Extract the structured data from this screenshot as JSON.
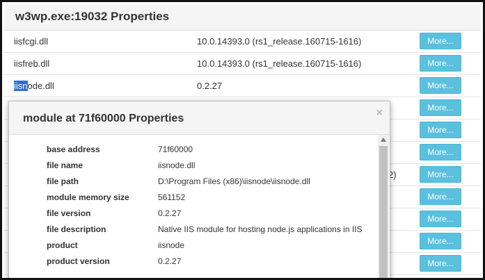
{
  "main": {
    "title": "w3wp.exe:19032 Properties",
    "rows": [
      {
        "name": "iisfcgi.dll",
        "version": "10.0.14393.0 (rs1_release.160715-1616)",
        "button": "More..."
      },
      {
        "name": "iisfreb.dll",
        "version": "10.0.14393.0 (rs1_release.160715-1616)",
        "button": "More..."
      },
      {
        "name_selected": "iisn",
        "name_rest": "ode.dll",
        "version": "0.2.27",
        "button": "More..."
      },
      {
        "button": "More..."
      },
      {
        "button": "More..."
      },
      {
        "button": "More..."
      },
      {
        "version_partial": "2)",
        "button": "More..."
      },
      {
        "button": "More..."
      },
      {
        "button": "More..."
      },
      {
        "button": "More..."
      },
      {
        "button": "More..."
      }
    ]
  },
  "modal": {
    "title": "module at 71f60000 Properties",
    "close": "×",
    "properties": [
      {
        "key": "base address",
        "value": "71f60000"
      },
      {
        "key": "file name",
        "value": "iisnode.dll"
      },
      {
        "key": "file path",
        "value": "D:\\Program Files (x86)\\iisnode\\iisnode.dll"
      },
      {
        "key": "module memory size",
        "value": "561152"
      },
      {
        "key": "file version",
        "value": "0.2.27"
      },
      {
        "key": "file description",
        "value": "Native IIS module for hosting node.js applications in IIS"
      },
      {
        "key": "product",
        "value": "iisnode"
      },
      {
        "key": "product version",
        "value": "0.2.27"
      }
    ]
  }
}
